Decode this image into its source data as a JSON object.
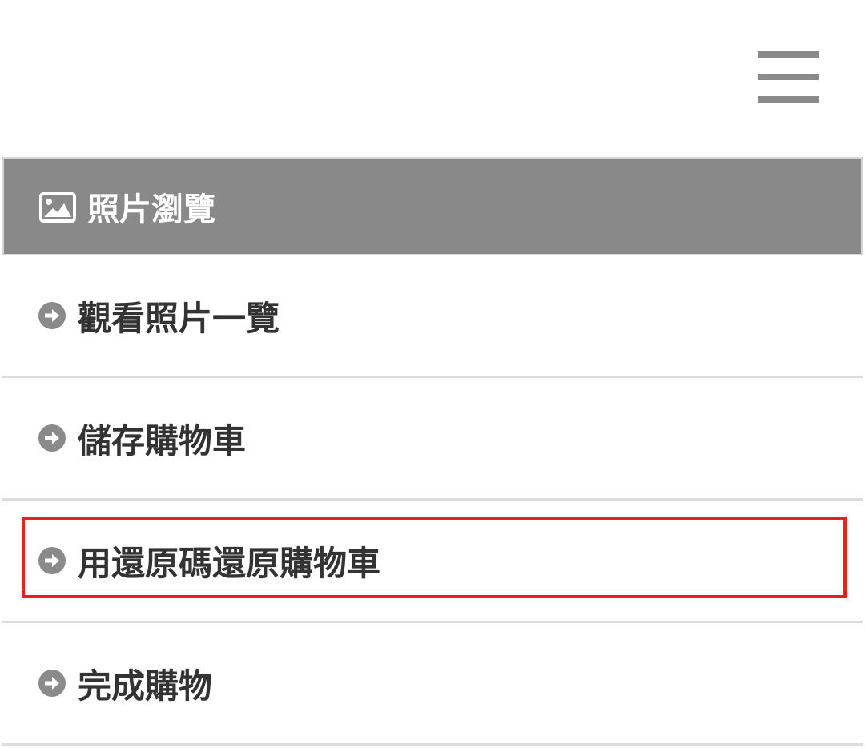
{
  "header": {
    "menu_icon": "hamburger-menu-icon"
  },
  "menu": {
    "section_icon": "image-icon",
    "section_title": "照片瀏覽",
    "item_icon": "arrow-circle-right-icon",
    "items": [
      {
        "label": "觀看照片一覽"
      },
      {
        "label": "儲存購物車"
      },
      {
        "label": "用還原碼還原購物車",
        "highlighted": true
      },
      {
        "label": "完成購物"
      }
    ]
  },
  "colors": {
    "header_bg": "#898989",
    "text": "#333333",
    "icon": "#8a8a8a",
    "highlight": "#e3231e"
  }
}
